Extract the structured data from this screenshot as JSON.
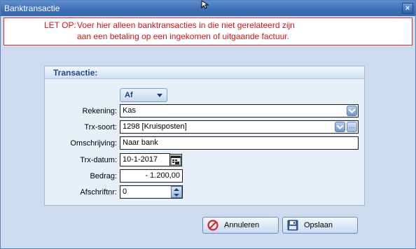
{
  "window": {
    "title": "Banktransactie",
    "close_glyph": "×"
  },
  "warning": {
    "label": "LET OP:",
    "line1": "Voer hier alleen banktransacties in die niet gerelateerd zijn",
    "line2": "aan een betaling op een ingekomen of uitgaande factuur."
  },
  "group": {
    "title": "Transactie:"
  },
  "direction": {
    "value": "Af"
  },
  "fields": {
    "rekening": {
      "label": "Rekening:",
      "value": "Kas"
    },
    "trx_soort": {
      "label": "Trx-soort:",
      "value": "1298 [Kruisposten]"
    },
    "omschrijving": {
      "label": "Omschrijving:",
      "value": "Naar bank"
    },
    "trx_datum": {
      "label": "Trx-datum:",
      "value": "10-1-2017"
    },
    "bedrag": {
      "label": "Bedrag:",
      "value": "- 1.200,00"
    },
    "afschriftnr": {
      "label": "Afschriftnr:",
      "value": "0"
    }
  },
  "buttons": {
    "cancel_label": "Annuleren",
    "save_label": "Opslaan"
  },
  "icons": {
    "cancel": "cancel-icon",
    "save": "floppy-disk-icon",
    "calendar": "calendar-icon"
  }
}
